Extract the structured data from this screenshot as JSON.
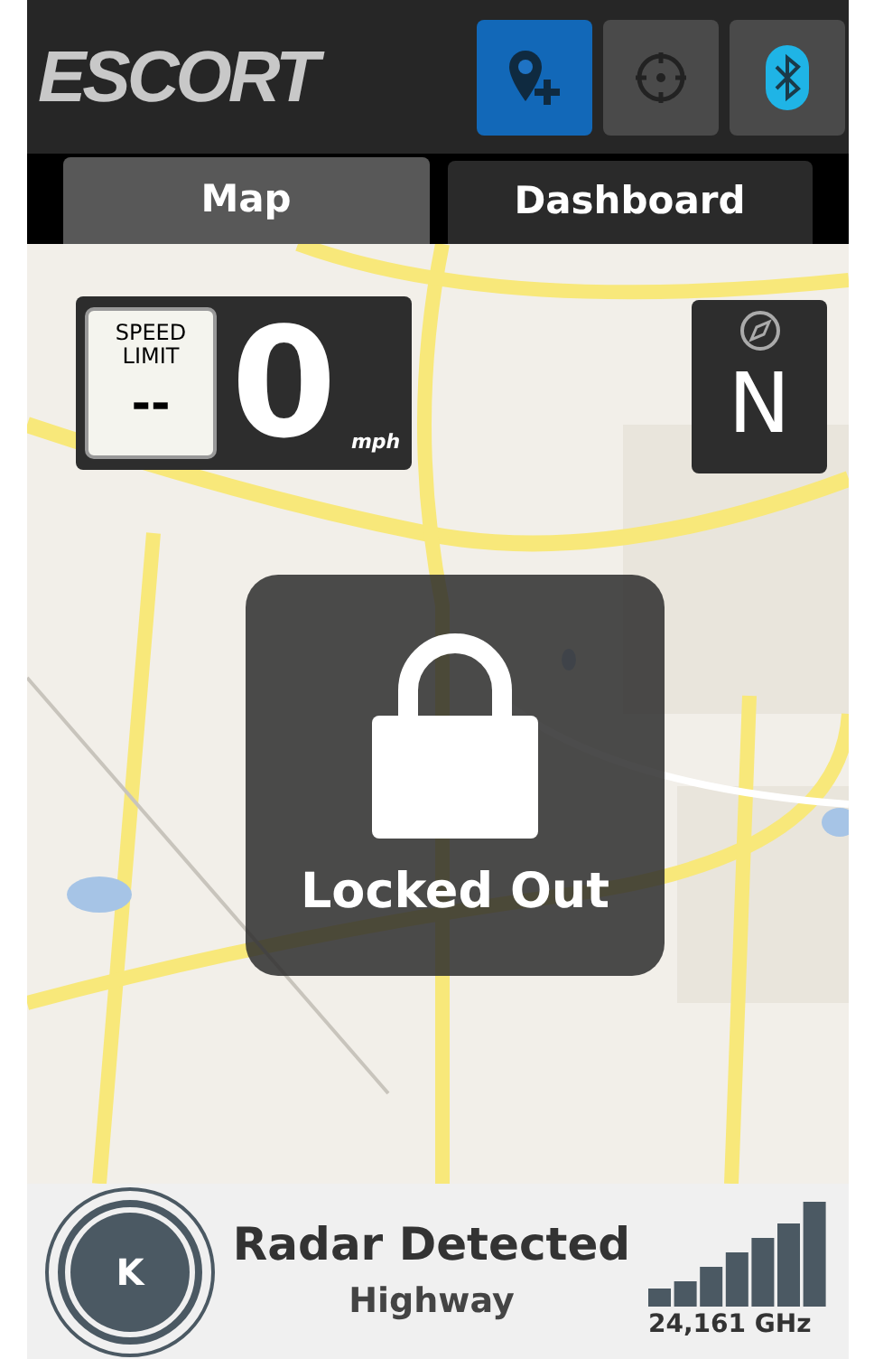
{
  "header": {
    "logo": "ESCORT",
    "buttons": [
      {
        "kind": "add-location",
        "on": true
      },
      {
        "kind": "locate",
        "on": false
      },
      {
        "kind": "bluetooth",
        "on": false
      }
    ]
  },
  "tabs": [
    {
      "label": "Map",
      "selected": true
    },
    {
      "label": "Dashboard",
      "selected": false
    }
  ],
  "map": {
    "kind": "picture",
    "speed": {
      "limit_label": "SPEED LIMIT",
      "limit_value": "--",
      "value": "0",
      "unit": "mph"
    },
    "heading": "N",
    "lock_message": "Locked Out"
  },
  "alert": {
    "band": "K",
    "title": "Radar Detected",
    "mode": "Highway",
    "frequency": "24,161 GHz"
  }
}
